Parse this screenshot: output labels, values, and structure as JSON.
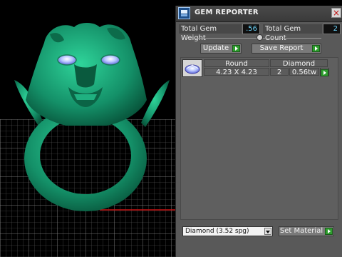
{
  "colors": {
    "ring": "#159068",
    "panel": "#595959",
    "value_text": "#6fd8ff",
    "grid": "#777777",
    "go_button": "#2e9e2e"
  },
  "viewport": {
    "description_icons": [
      "grid-plane",
      "ring-model",
      "gem-stones"
    ]
  },
  "panel": {
    "title": "GEM REPORTER",
    "close_icon": "close-icon",
    "total_gem_weight_label": "Total Gem Weight",
    "total_gem_weight_value": ".56",
    "total_gem_count_label": "Total Gem Count",
    "total_gem_count_value": "2",
    "update_label": "Update",
    "save_report_label": "Save Report",
    "gems": [
      {
        "shape": "Round",
        "material": "Diamond",
        "size": "4.23 X 4.23",
        "count": "2",
        "weight": "0.56tw"
      }
    ],
    "material_selected": "Diamond      (3.52 spg)",
    "set_material_label": "Set Material"
  }
}
